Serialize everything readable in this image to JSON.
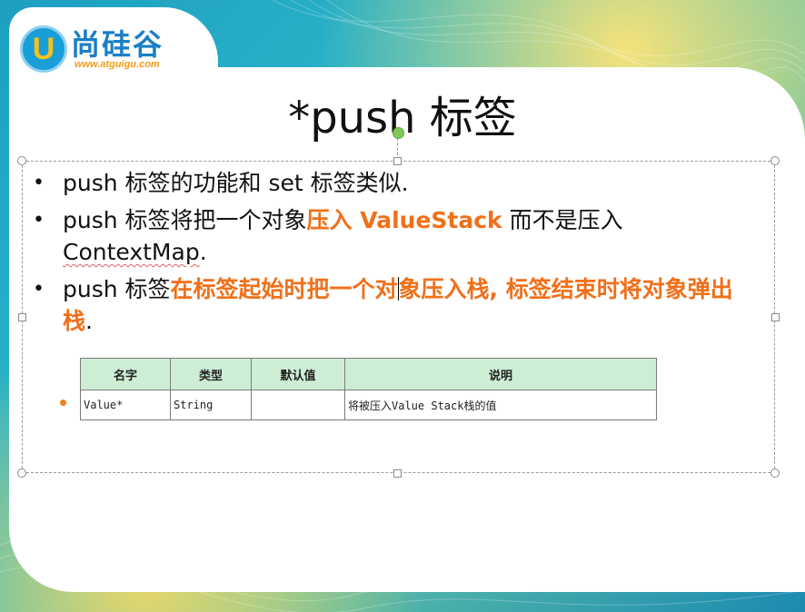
{
  "logo": {
    "letter": "U",
    "brand_name": "尚硅谷",
    "url": "www.atguigu.com"
  },
  "slide": {
    "title": "*push 标签",
    "bullets": [
      {
        "text_before": "push 标签的功能和 set 标签类似.",
        "highlight": "",
        "text_after": "",
        "highlight_color": "#f0701a"
      },
      {
        "text_before": "push 标签将把一个对象",
        "highlight": "压入 ValueStack",
        "text_after_1": " 而不是压入 ",
        "text_after_2": "ContextMap",
        "text_after_3": "."
      },
      {
        "text_before": "push 标签",
        "highlight_1": "在标签起始时把一个对",
        "highlight_2": "象压入栈, 标签结束时将对象弹出栈",
        "text_after": "."
      }
    ],
    "table": {
      "headers": [
        "名字",
        "类型",
        "默认值",
        "说明"
      ],
      "rows": [
        [
          "Value*",
          "String",
          "",
          "将被压入Value Stack栈的值"
        ]
      ],
      "header_bg": "#cdeed5"
    }
  },
  "colors": {
    "accent_orange": "#f0701a",
    "logo_blue": "#1a7fc6",
    "selection_rotate_handle": "#7fc95a"
  }
}
